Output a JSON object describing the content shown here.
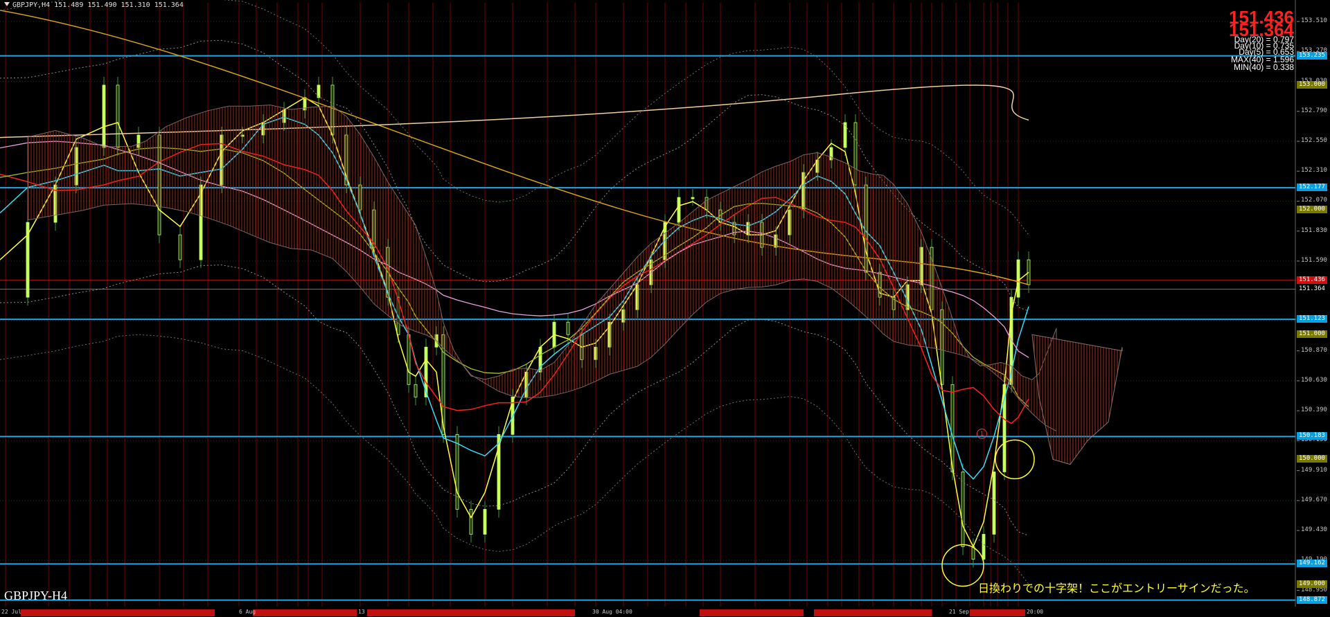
{
  "window": {
    "header": "GBPJPY,H4  151.489 151.490 151.310 151.364"
  },
  "prices": {
    "bid": "151.436",
    "ask": "151.364"
  },
  "stats": [
    "Day(20) = 0.797",
    "Day(10) = 0.735",
    "Day(5) = 0.653",
    "MAX(40) = 1.596",
    "MIN(40) = 0.338"
  ],
  "symbol_label": "GBPJPY-H4",
  "annotation": "日換わりでの十字架！ここがエントリーサインだった。",
  "marker_label": "1",
  "y_axis": {
    "ticks": [
      "153.510",
      "153.270",
      "153.030",
      "152.790",
      "152.550",
      "152.310",
      "152.070",
      "151.830",
      "151.590",
      "151.350",
      "151.110",
      "150.870",
      "150.630",
      "150.390",
      "150.150",
      "149.910",
      "149.670",
      "149.430",
      "149.190",
      "148.950"
    ],
    "tick_values": [
      153.51,
      153.27,
      153.03,
      152.79,
      152.55,
      152.31,
      152.07,
      151.83,
      151.59,
      151.35,
      151.11,
      150.87,
      150.63,
      150.39,
      150.15,
      149.91,
      149.67,
      149.43,
      149.19,
      148.95
    ],
    "range": [
      148.82,
      153.66
    ]
  },
  "level_tags": [
    {
      "label": "153.235",
      "value": 153.235,
      "bg": "#0aa0e0",
      "fg": "#ffffff"
    },
    {
      "label": "153.000",
      "value": 153.0,
      "bg": "#7a7a00",
      "fg": "#ffffff"
    },
    {
      "label": "152.177",
      "value": 152.177,
      "bg": "#0aa0e0",
      "fg": "#ffffff"
    },
    {
      "label": "152.000",
      "value": 152.0,
      "bg": "#7a7a00",
      "fg": "#ffffff"
    },
    {
      "label": "151.436",
      "value": 151.436,
      "bg": "#d01010",
      "fg": "#ffffff"
    },
    {
      "label": "151.364",
      "value": 151.364,
      "bg": "#000000",
      "fg": "#ffffff"
    },
    {
      "label": "151.123",
      "value": 151.123,
      "bg": "#0aa0e0",
      "fg": "#ffffff"
    },
    {
      "label": "151.000",
      "value": 151.0,
      "bg": "#7a7a00",
      "fg": "#ffffff"
    },
    {
      "label": "150.183",
      "value": 150.183,
      "bg": "#0aa0e0",
      "fg": "#ffffff"
    },
    {
      "label": "150.000",
      "value": 150.0,
      "bg": "#7a7a00",
      "fg": "#ffffff"
    },
    {
      "label": "149.162",
      "value": 149.162,
      "bg": "#0aa0e0",
      "fg": "#ffffff"
    },
    {
      "label": "149.000",
      "value": 149.0,
      "bg": "#7a7a00",
      "fg": "#ffffff"
    },
    {
      "label": "148.872",
      "value": 148.872,
      "bg": "#0aa0e0",
      "fg": "#ffffff"
    }
  ],
  "x_axis": {
    "ticks": [
      "22 Jul",
      "6 Aug",
      "13",
      "30 Aug 04:00",
      "21 Sep",
      "20:00"
    ]
  },
  "colors": {
    "background": "#000000",
    "grid": "#2a2a2a",
    "level_line": "#1aa8e8",
    "vline": "#8b0000",
    "candle": "#c8ff60",
    "ma_yellow": "#ffff40",
    "ma_cyan": "#30e0ff",
    "ma_red": "#ff2020",
    "ma_orange": "#d4a017",
    "ma_pink": "#e8a0e0",
    "ma_beige": "#f0d0a0",
    "cloud_red": "#a03020",
    "cloud_blue": "#2020a0",
    "annotation": "#ffff30"
  }
}
